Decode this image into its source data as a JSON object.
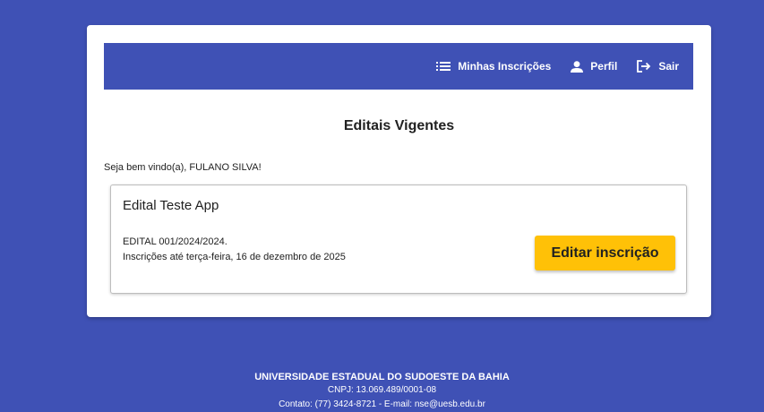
{
  "nav": {
    "my_registrations": "Minhas Inscrições",
    "profile": "Perfil",
    "logout": "Sair"
  },
  "main": {
    "title": "Editais Vigentes",
    "welcome": "Seja bem vindo(a), FULANO SILVA!"
  },
  "edital": {
    "title": "Edital Teste App",
    "number": "EDITAL 001/2024/2024.",
    "deadline": "Inscrições até terça-feira, 16 de dezembro de 2025",
    "action_label": "Editar inscrição"
  },
  "footer": {
    "university": "UNIVERSIDADE ESTADUAL DO SUDOESTE DA BAHIA",
    "cnpj": "CNPJ: 13.069.489/0001-08",
    "contact": "Contato: (77) 3424-8721 - E-mail: nse@uesb.edu.br"
  },
  "colors": {
    "primary": "#3f51b5",
    "accent": "#ffc107",
    "card_background": "#ffffff"
  },
  "icons": {
    "my_registrations": "list-icon",
    "profile": "person-icon",
    "logout": "logout-icon"
  }
}
